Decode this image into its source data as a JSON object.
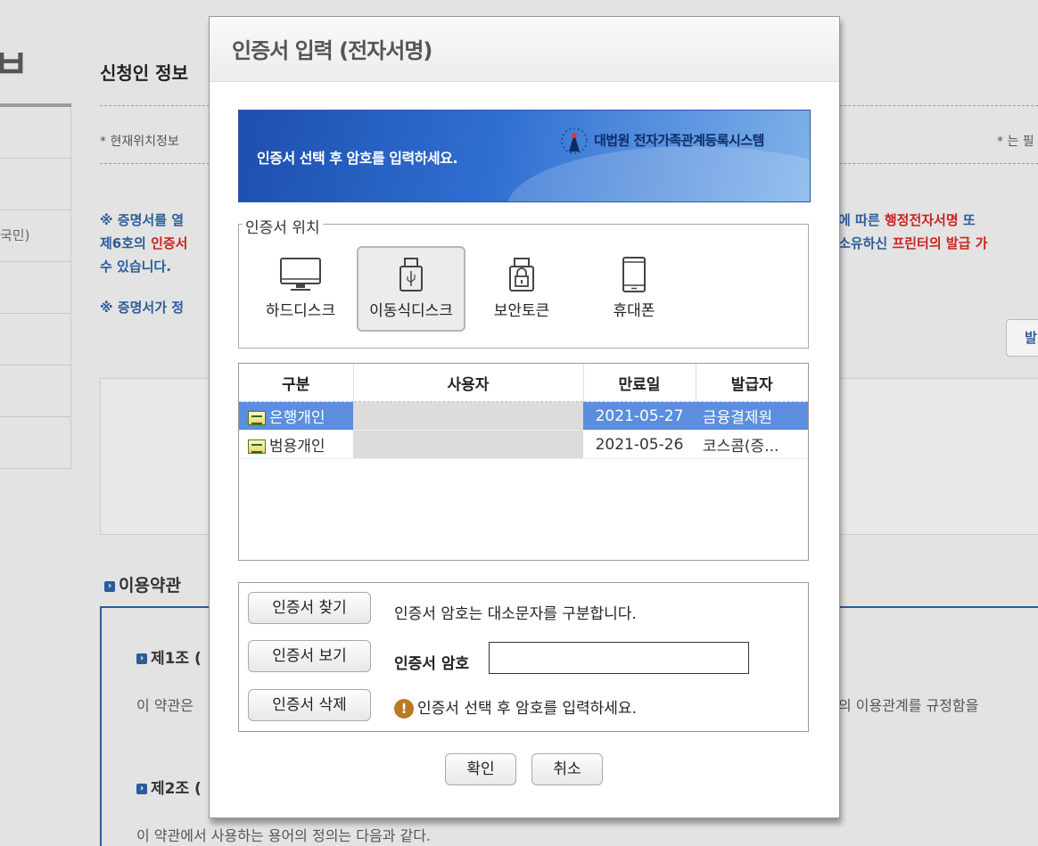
{
  "background": {
    "big_char": "ㅂ",
    "title": "신청인 정보",
    "nav_item_partial": "국민)",
    "location_text": "* 현재위치정보",
    "required_note": "* 는 필",
    "notice_line1_a": "※ 증명서를 열",
    "notice_line2_a": "제6호의 ",
    "notice_line2_red": "인증서",
    "notice_line3": "수 있습니다.",
    "notice_right_1a": "에 따른 ",
    "notice_right_1red": "행정전자서명",
    "notice_right_1b": " 또",
    "notice_right_2a": "소유하신 ",
    "notice_right_2red": "프린터의 발급 가",
    "notice2": "※ 증명서가 정",
    "right_button": "발",
    "terms_title": "이용약관",
    "article1": "제1조 (",
    "article1_text": "이 약관은",
    "article1_right": "의 이용관계를 규정함을",
    "article2": "제2조 (",
    "article2_text": "이 약관에서 사용하는 용어의 정의는 다음과 같다."
  },
  "dialog": {
    "title": "인증서 입력 (전자서명)",
    "banner_text": "인증서 선택 후 암호를 입력하세요.",
    "banner_logo": "대법원 전자가족관계등록시스템",
    "location_legend": "인증서 위치",
    "locations": [
      {
        "label": "하드디스크",
        "icon": "monitor-icon"
      },
      {
        "label": "이동식디스크",
        "icon": "usb-icon",
        "selected": true
      },
      {
        "label": "보안토큰",
        "icon": "lock-token-icon"
      },
      {
        "label": "휴대폰",
        "icon": "phone-icon"
      }
    ],
    "table": {
      "headers": [
        "구분",
        "사용자",
        "만료일",
        "발급자"
      ],
      "rows": [
        {
          "type": "은행개인",
          "user": "",
          "expires": "2021-05-27",
          "issuer": "금융결제원",
          "selected": true
        },
        {
          "type": "범용개인",
          "user": "",
          "expires": "2021-05-26",
          "issuer": "코스콤(증..."
        }
      ]
    },
    "buttons": {
      "find": "인증서 찾기",
      "view": "인증서 보기",
      "delete": "인증서 삭제",
      "ok": "확인",
      "cancel": "취소"
    },
    "case_hint": "인증서 암호는 대소문자를 구분합니다.",
    "password_label": "인증서 암호",
    "password_value": "",
    "warning": "인증서 선택 후 암호를 입력하세요."
  },
  "colors": {
    "selected_row": "#5b8edc",
    "banner": "#2f6fd2",
    "notice_blue": "#2b5d9a",
    "notice_red": "#c8231e"
  }
}
